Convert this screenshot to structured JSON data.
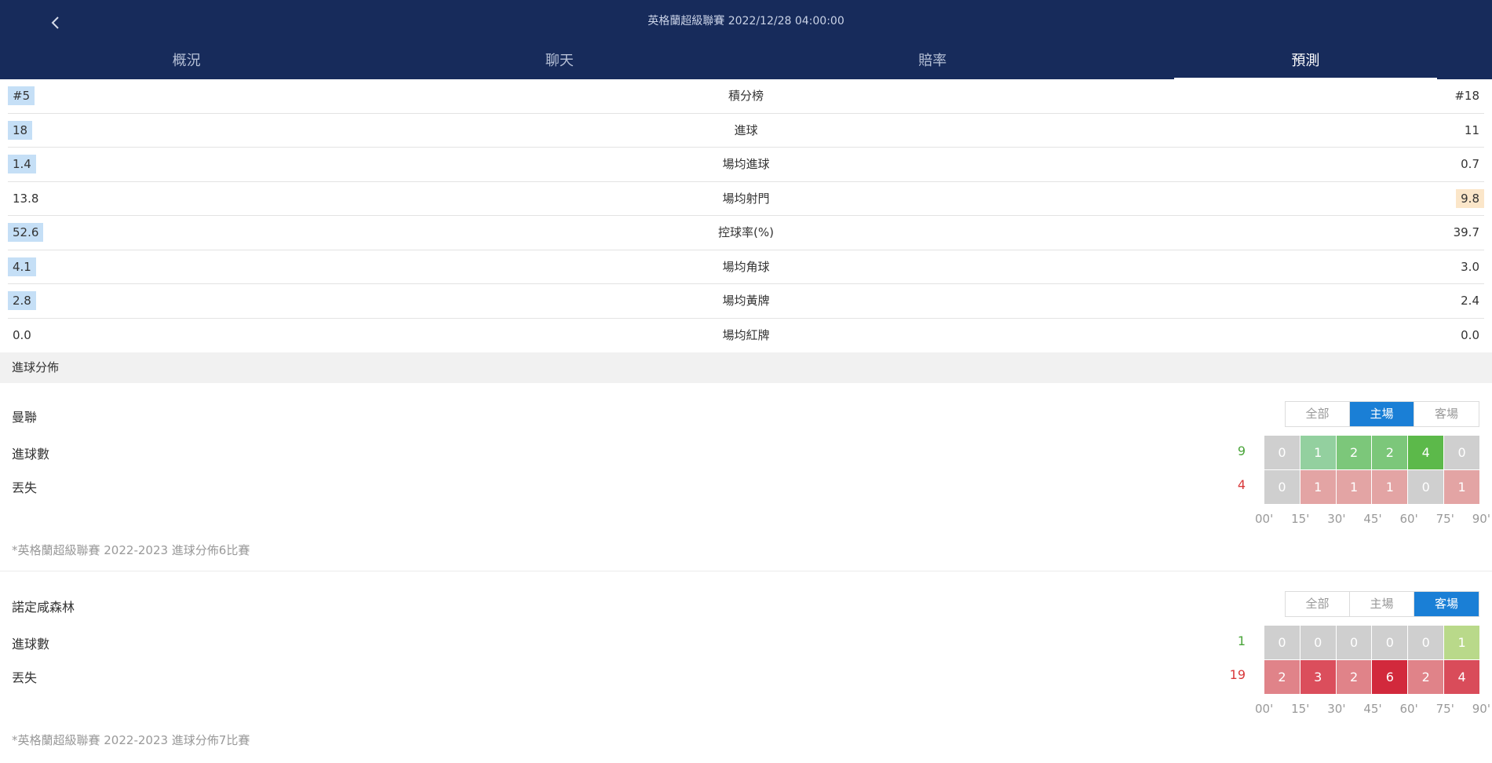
{
  "header": {
    "title": "英格蘭超級聯賽 2022/12/28 04:00:00",
    "tabs": [
      {
        "label": "概況"
      },
      {
        "label": "聊天"
      },
      {
        "label": "賠率"
      },
      {
        "label": "預測",
        "active": true
      }
    ]
  },
  "stats": [
    {
      "label": "積分榜",
      "home": "#5",
      "away": "#18",
      "highlight": "home"
    },
    {
      "label": "進球",
      "home": "18",
      "away": "11",
      "highlight": "home"
    },
    {
      "label": "場均進球",
      "home": "1.4",
      "away": "0.7",
      "highlight": "home"
    },
    {
      "label": "場均射門",
      "home": "13.8",
      "away": "9.8",
      "highlight": "away"
    },
    {
      "label": "控球率(%)",
      "home": "52.6",
      "away": "39.7",
      "highlight": "home"
    },
    {
      "label": "場均角球",
      "home": "4.1",
      "away": "3.0",
      "highlight": "home"
    },
    {
      "label": "場均黃牌",
      "home": "2.8",
      "away": "2.4",
      "highlight": "home"
    },
    {
      "label": "場均紅牌",
      "home": "0.0",
      "away": "0.0",
      "highlight": "none"
    }
  ],
  "distribution": {
    "section_title": "進球分佈",
    "ticks": [
      "00'",
      "15'",
      "30'",
      "45'",
      "60'",
      "75'",
      "90'"
    ],
    "teams": [
      {
        "name": "曼聯",
        "filters": [
          "全部",
          "主場",
          "客場"
        ],
        "active_filter": "主場",
        "goals_label": "進球數",
        "goals_total": "9",
        "goals": [
          "0",
          "1",
          "2",
          "2",
          "4",
          "0"
        ],
        "conceded_label": "丟失",
        "conceded_total": "4",
        "conceded": [
          "0",
          "1",
          "1",
          "1",
          "0",
          "1"
        ],
        "note": "*英格蘭超級聯賽 2022-2023 進球分佈6比賽"
      },
      {
        "name": "諾定咸森林",
        "filters": [
          "全部",
          "主場",
          "客場"
        ],
        "active_filter": "客場",
        "goals_label": "進球數",
        "goals_total": "1",
        "goals": [
          "0",
          "0",
          "0",
          "0",
          "0",
          "1"
        ],
        "conceded_label": "丟失",
        "conceded_total": "19",
        "conceded": [
          "2",
          "3",
          "2",
          "6",
          "2",
          "4"
        ],
        "note": "*英格蘭超級聯賽 2022-2023 進球分佈7比賽"
      }
    ]
  },
  "colors": {
    "header_bg": "#172b5b",
    "home_highlight": "#c5dff6",
    "away_highlight": "#fbe6c9",
    "filter_active": "#1a7fd6",
    "zero_cell": "#cfcfcf",
    "goals_total": "#4aa53a",
    "conceded_total": "#d9383a"
  },
  "icons": {
    "back": "chevron-left-icon"
  }
}
